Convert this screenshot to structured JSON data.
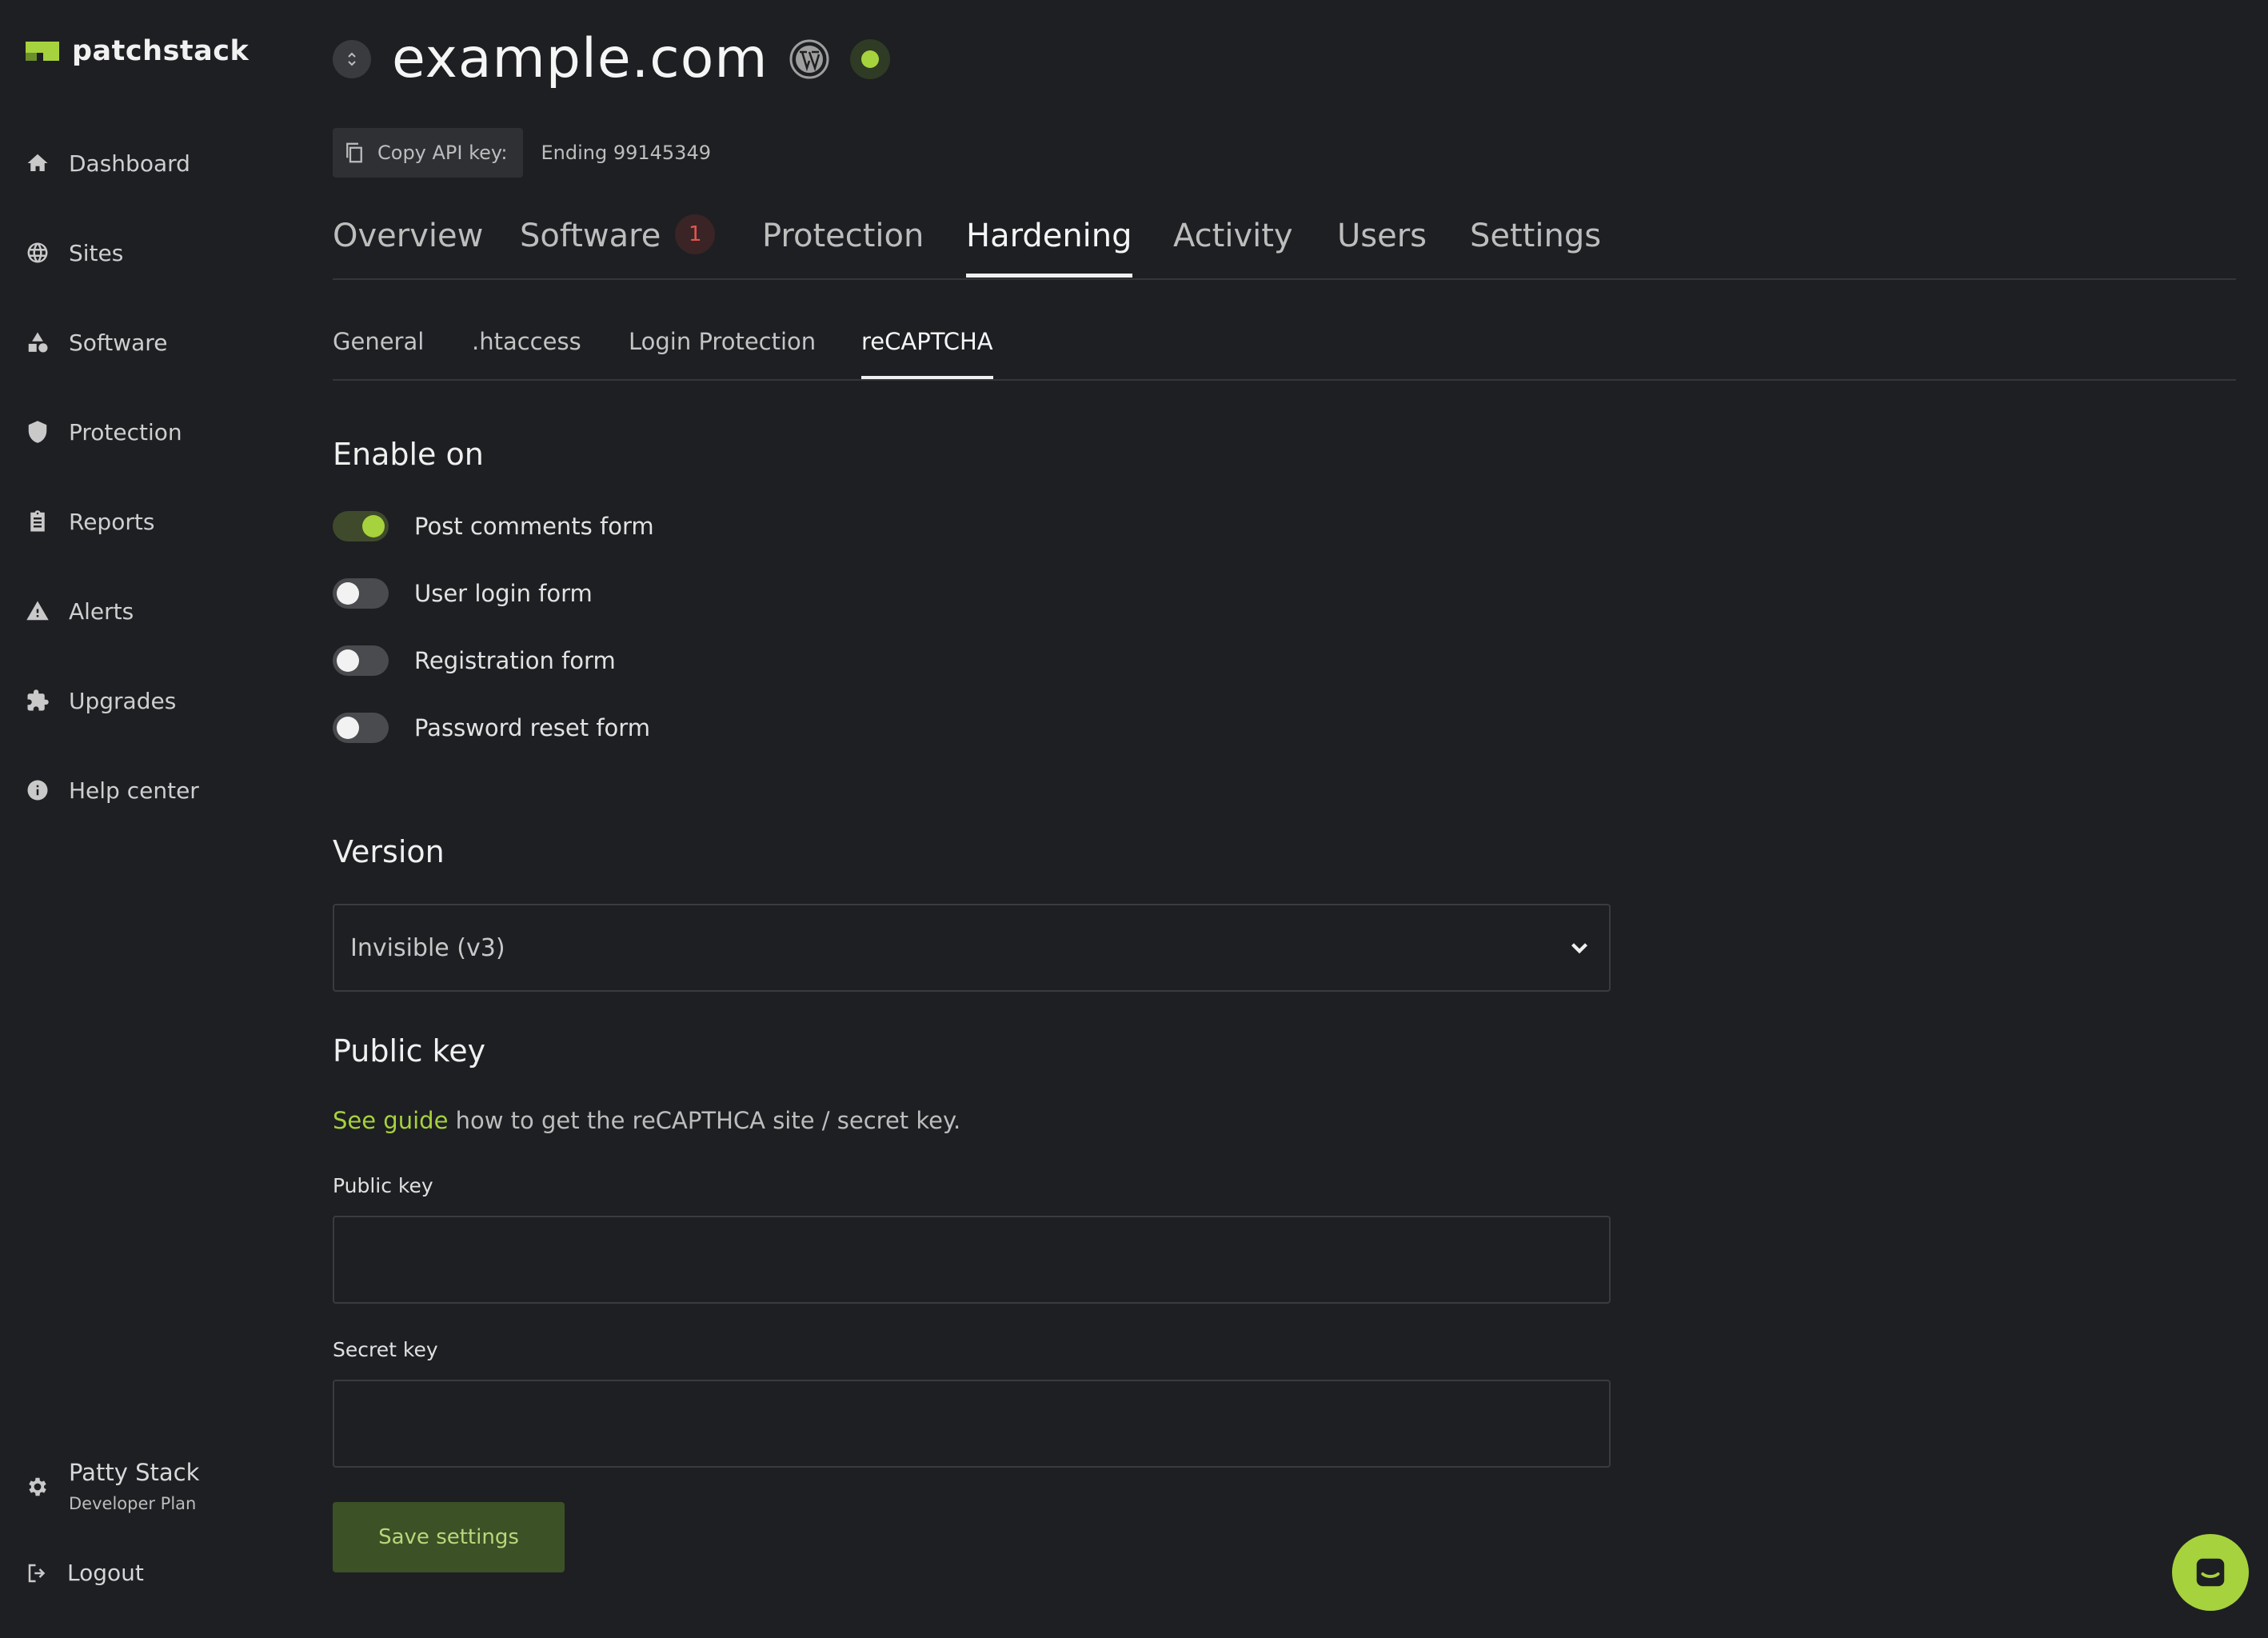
{
  "brand": {
    "name": "patchstack",
    "accent": "#a6d23d"
  },
  "sidebar": {
    "items": [
      {
        "label": "Dashboard",
        "icon": "home-icon"
      },
      {
        "label": "Sites",
        "icon": "globe-icon"
      },
      {
        "label": "Software",
        "icon": "shapes-icon"
      },
      {
        "label": "Protection",
        "icon": "shield-icon"
      },
      {
        "label": "Reports",
        "icon": "clipboard-icon"
      },
      {
        "label": "Alerts",
        "icon": "warning-icon"
      },
      {
        "label": "Upgrades",
        "icon": "puzzle-icon"
      },
      {
        "label": "Help center",
        "icon": "info-icon"
      }
    ],
    "user": {
      "name": "Patty Stack",
      "plan": "Developer Plan"
    },
    "logout_label": "Logout"
  },
  "header": {
    "site_title": "example.com",
    "api_button_label": "Copy API key:",
    "api_ending": "Ending 99145349"
  },
  "tabs": [
    {
      "label": "Overview"
    },
    {
      "label": "Software",
      "badge": "1"
    },
    {
      "label": "Protection"
    },
    {
      "label": "Hardening",
      "active": true
    },
    {
      "label": "Activity"
    },
    {
      "label": "Users"
    },
    {
      "label": "Settings"
    }
  ],
  "subtabs": [
    {
      "label": "General"
    },
    {
      "label": ".htaccess"
    },
    {
      "label": "Login Protection"
    },
    {
      "label": "reCAPTCHA",
      "active": true
    }
  ],
  "enable_on": {
    "heading": "Enable on",
    "toggles": [
      {
        "label": "Post comments form",
        "on": true
      },
      {
        "label": "User login form",
        "on": false
      },
      {
        "label": "Registration form",
        "on": false
      },
      {
        "label": "Password reset form",
        "on": false
      }
    ]
  },
  "version": {
    "heading": "Version",
    "selected": "Invisible (v3)"
  },
  "public_key_section": {
    "heading": "Public key",
    "guide_link": "See guide",
    "guide_text": " how to get the reCAPTHCA site / secret key.",
    "public_key_label": "Public key",
    "public_key_value": "",
    "secret_key_label": "Secret key",
    "secret_key_value": ""
  },
  "save_button_label": "Save settings",
  "chat_icon": "chat-icon"
}
